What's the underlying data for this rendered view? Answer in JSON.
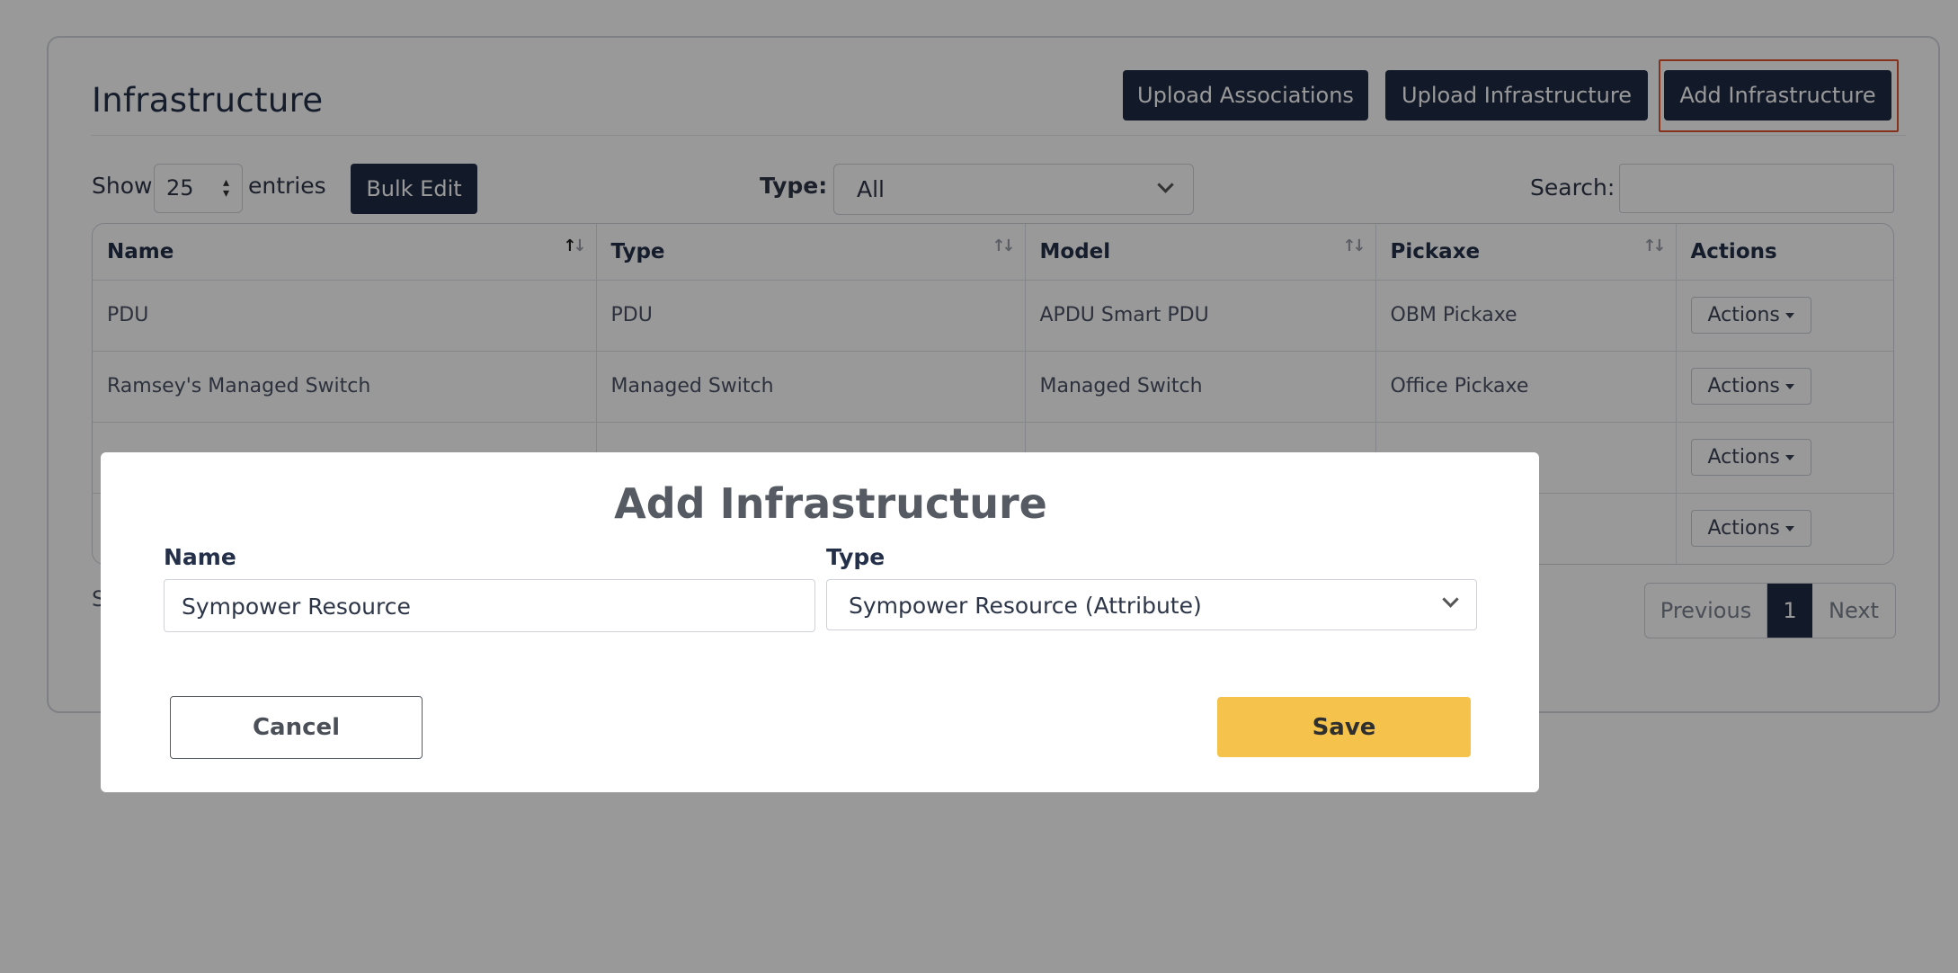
{
  "page": {
    "title": "Infrastructure",
    "header_buttons": {
      "upload_associations": "Upload Associations",
      "upload_infrastructure": "Upload Infrastructure",
      "add_infrastructure": "Add Infrastructure"
    },
    "controls": {
      "show_label": "Show",
      "page_size": "25",
      "entries_label": "entries",
      "bulk_edit": "Bulk Edit",
      "type_label": "Type:",
      "type_value": "All",
      "search_label": "Search:"
    },
    "table": {
      "columns": [
        "Name",
        "Type",
        "Model",
        "Pickaxe",
        "Actions"
      ],
      "rows": [
        {
          "name": "PDU",
          "type": "PDU",
          "model": "APDU Smart PDU",
          "pickaxe": "OBM Pickaxe",
          "action": "Actions"
        },
        {
          "name": "Ramsey's Managed Switch",
          "type": "Managed Switch",
          "model": "Managed Switch",
          "pickaxe": "Office Pickaxe",
          "action": "Actions"
        },
        {
          "name": "",
          "type": "",
          "model": "",
          "pickaxe": "",
          "action": "Actions"
        },
        {
          "name": "",
          "type": "",
          "model": "",
          "pickaxe": "",
          "action": "Actions"
        }
      ]
    },
    "footer": {
      "showing_text": "S",
      "previous": "Previous",
      "current_page": "1",
      "next": "Next"
    }
  },
  "modal": {
    "title": "Add Infrastructure",
    "name_label": "Name",
    "name_value": "Sympower Resource",
    "type_label": "Type",
    "type_value": "Sympower Resource (Attribute)",
    "cancel": "Cancel",
    "save": "Save"
  },
  "colors": {
    "primary_button": "#1f2a44",
    "save_button": "#f5c34c",
    "focus_ring": "#e0532f",
    "overlay": "rgba(0,0,0,0.4)"
  }
}
